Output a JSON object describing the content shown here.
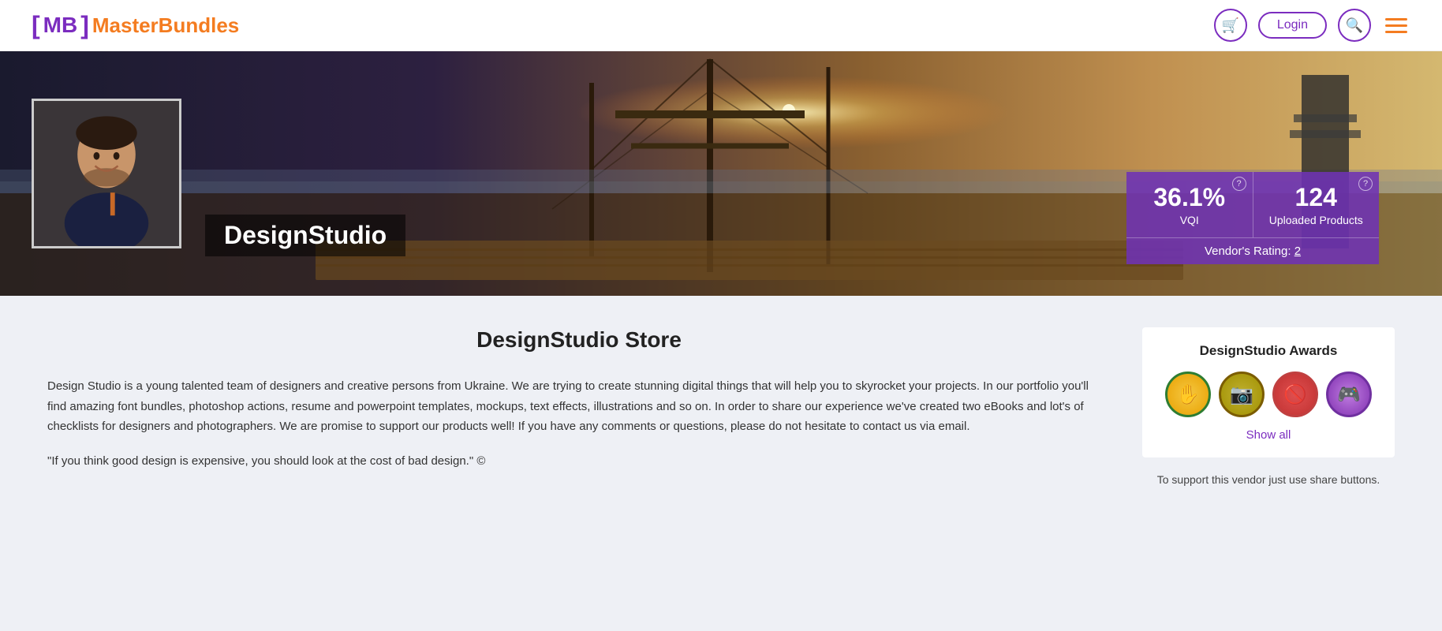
{
  "header": {
    "logo": {
      "bracket_open": "[",
      "mb": "MB",
      "bracket_close": "]",
      "brand_name": "MasterBundles"
    },
    "nav": {
      "cart_icon": "🛒",
      "login_label": "Login",
      "search_icon": "🔍",
      "menu_icon": "≡"
    }
  },
  "hero": {
    "vendor_name": "DesignStudio",
    "stats": {
      "vqi_value": "36.1%",
      "vqi_label": "VQI",
      "uploaded_value": "124",
      "uploaded_label": "Uploaded Products",
      "rating_label": "Vendor's Rating:",
      "rating_value": "2"
    }
  },
  "main": {
    "store_title": "DesignStudio Store",
    "description_p1": "Design Studio is a young talented team of designers and creative persons from Ukraine. We are trying to create stunning digital things that will help you to skyrocket your projects. In our portfolio you'll find amazing font bundles, photoshop actions, resume and powerpoint templates, mockups, text effects, illustrations and so on. In order to share our experience we've created two eBooks and lot's of checklists for designers and photographers. We are promise to support our products well! If you have any comments or questions, please do not hesitate to contact us via email.",
    "description_quote": "\"If you think good design is expensive, you should look at the cost of bad design.\" ©",
    "sidebar": {
      "awards_title": "DesignStudio Awards",
      "show_all_label": "Show all",
      "support_text": "To support this vendor just use share buttons.",
      "badges": [
        {
          "icon": "✋",
          "color_bg": "#f5c842",
          "border": "#2e7d32"
        },
        {
          "icon": "📷",
          "color_bg": "#c0b030",
          "border": "#7b5c00"
        },
        {
          "icon": "🚫",
          "color_bg": "#e05050",
          "border": "#c04040"
        },
        {
          "icon": "🎮",
          "color_bg": "#c07de0",
          "border": "#7030a0"
        }
      ]
    }
  }
}
